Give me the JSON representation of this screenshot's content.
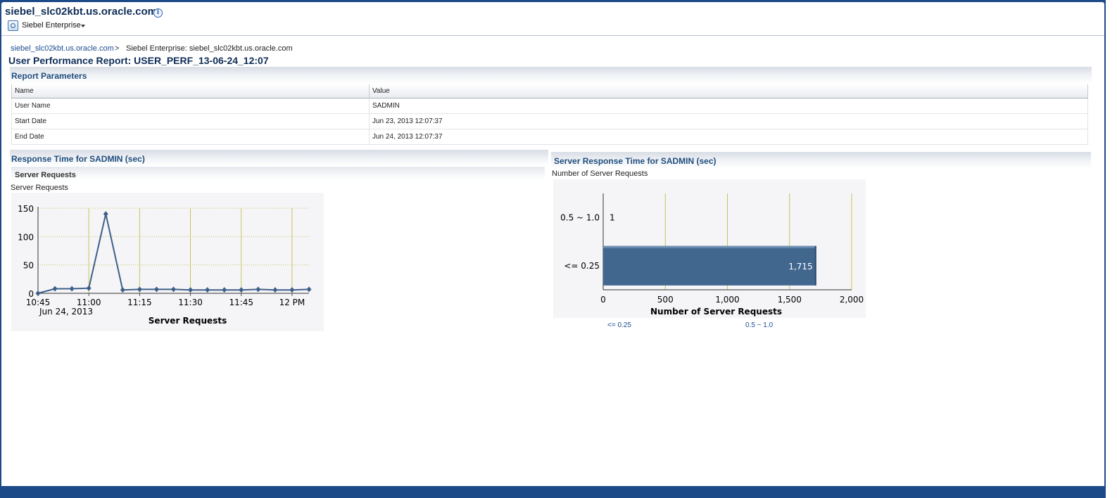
{
  "header": {
    "host_title": "siebel_slc02kbt.us.oracle.com",
    "info_icon": "info-icon",
    "target_menu_icon": "siebel-target-icon",
    "target_menu_label": "Siebel Enterprise"
  },
  "breadcrumb": {
    "link": "siebel_slc02kbt.us.oracle.com",
    "separator": ">",
    "current": "Siebel Enterprise: siebel_slc02kbt.us.oracle.com"
  },
  "page_title": "User Performance Report: USER_PERF_13-06-24_12:07",
  "report_parameters": {
    "title": "Report Parameters",
    "columns": [
      "Name",
      "Value"
    ],
    "rows": [
      [
        "User Name",
        "SADMIN"
      ],
      [
        "Start Date",
        "Jun 23, 2013 12:07:37"
      ],
      [
        "End Date",
        "Jun 24, 2013 12:07:37"
      ]
    ]
  },
  "response_time": {
    "title": "Response Time for SADMIN (sec)",
    "subsection": "Server Requests",
    "caption": "Server Requests"
  },
  "server_response_time": {
    "title": "Server Response Time for SADMIN (sec)",
    "caption": "Number of Server Requests",
    "legend": [
      "<= 0.25",
      "0.5 ~ 1.0"
    ]
  },
  "chart_data": [
    {
      "type": "line",
      "title": "",
      "xlabel": "Server Requests",
      "ylabel": "",
      "x_tick_labels": [
        "10:45",
        "11:00",
        "11:15",
        "11:30",
        "11:45",
        "12 PM"
      ],
      "x_date_label": "Jun 24, 2013",
      "xlim": [
        "10:45",
        "12:05"
      ],
      "ylim": [
        0,
        150
      ],
      "y_ticks": [
        0,
        50,
        100,
        150
      ],
      "grid": true,
      "color": "#3e5f87",
      "x": [
        "10:45",
        "10:50",
        "10:55",
        "11:00",
        "11:05",
        "11:10",
        "11:15",
        "11:20",
        "11:25",
        "11:30",
        "11:35",
        "11:40",
        "11:45",
        "11:50",
        "11:55",
        "12:00",
        "12:05"
      ],
      "values": [
        0,
        8,
        8,
        9,
        140,
        6,
        7,
        7,
        7,
        6,
        6,
        6,
        6,
        7,
        6,
        6,
        7
      ]
    },
    {
      "type": "bar",
      "orientation": "horizontal",
      "title": "",
      "xlabel": "Number of Server Requests",
      "ylabel": "",
      "categories": [
        "0.5 ~ 1.0",
        "<= 0.25"
      ],
      "values": [
        1,
        1715
      ],
      "value_labels": [
        "1",
        "1,715"
      ],
      "xlim": [
        0,
        2000
      ],
      "x_ticks": [
        0,
        500,
        1000,
        1500,
        2000
      ],
      "x_tick_labels": [
        "0",
        "500",
        "1,000",
        "1,500",
        "2,000"
      ],
      "grid": true,
      "color": "#42678f"
    }
  ]
}
